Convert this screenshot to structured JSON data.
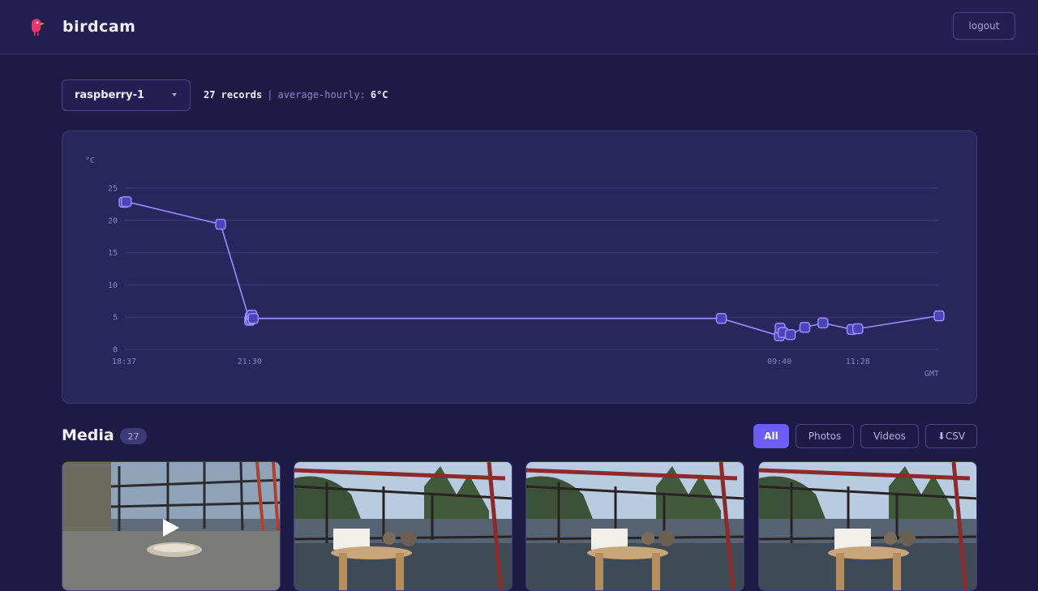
{
  "app": {
    "name": "birdcam",
    "logout_label": "logout"
  },
  "device_select": {
    "value": "raspberry-1"
  },
  "summary": {
    "records": "27 records",
    "separator": "|",
    "average_label": "average-hourly:",
    "average_value": "6°C"
  },
  "chart_data": {
    "type": "line",
    "ylabel": "°C",
    "timezone_label": "GMT",
    "ylim": [
      0,
      25
    ],
    "y_ticks": [
      "0",
      "5",
      "10",
      "15",
      "20",
      "25"
    ],
    "x_ticks": [
      "18:37",
      "21:30",
      "09:40",
      "11:28"
    ],
    "grid": true,
    "color": "#9b8cff",
    "x": [
      "18:37",
      "18:40",
      "20:50",
      "21:30",
      "21:31",
      "21:32",
      "21:33",
      "21:35",
      "08:20",
      "09:40",
      "09:41",
      "09:45",
      "09:55",
      "10:15",
      "10:40",
      "11:20",
      "11:28",
      "13:20"
    ],
    "values": [
      22.8,
      22.9,
      19.4,
      4.5,
      5.0,
      4.7,
      5.3,
      4.8,
      4.8,
      2.1,
      3.3,
      2.6,
      2.3,
      3.4,
      4.1,
      3.1,
      3.2,
      5.2
    ]
  },
  "media": {
    "title": "Media",
    "count": "27",
    "filters": [
      "All",
      "Photos",
      "Videos",
      "⬇CSV"
    ],
    "active_filter": "All",
    "items": [
      {
        "kind": "video"
      },
      {
        "kind": "photo"
      },
      {
        "kind": "photo"
      },
      {
        "kind": "photo"
      }
    ]
  }
}
